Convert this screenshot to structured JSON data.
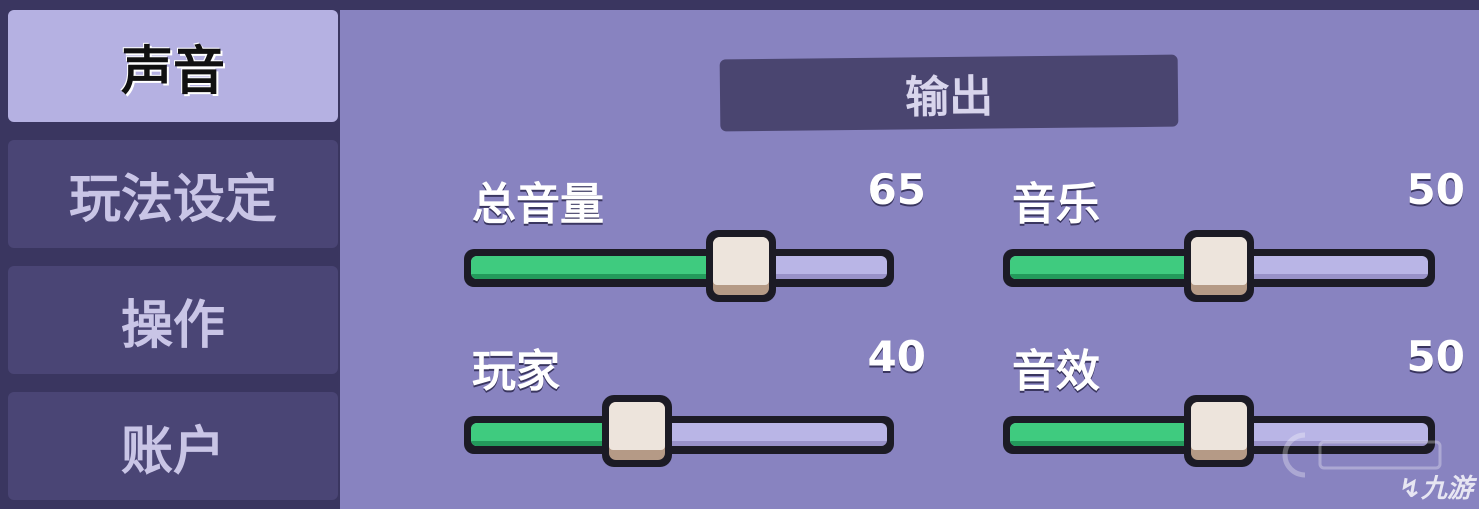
{
  "tabs": [
    {
      "label": "声音",
      "active": true
    },
    {
      "label": "玩法设定",
      "active": false
    },
    {
      "label": "操作",
      "active": false
    },
    {
      "label": "账户",
      "active": false
    }
  ],
  "section": {
    "title": "输出"
  },
  "sliders": [
    {
      "label": "总音量",
      "value": 65
    },
    {
      "label": "音乐",
      "value": 50
    },
    {
      "label": "玩家",
      "value": 40
    },
    {
      "label": "音效",
      "value": 50
    }
  ],
  "watermark": {
    "text": "九游"
  },
  "colors": {
    "background": "#8883c0",
    "sidebar": "#3a3660",
    "active_tab": "#b5b1e2",
    "fill_green": "#3fcb7f",
    "track_empty": "#b9b5e6"
  }
}
